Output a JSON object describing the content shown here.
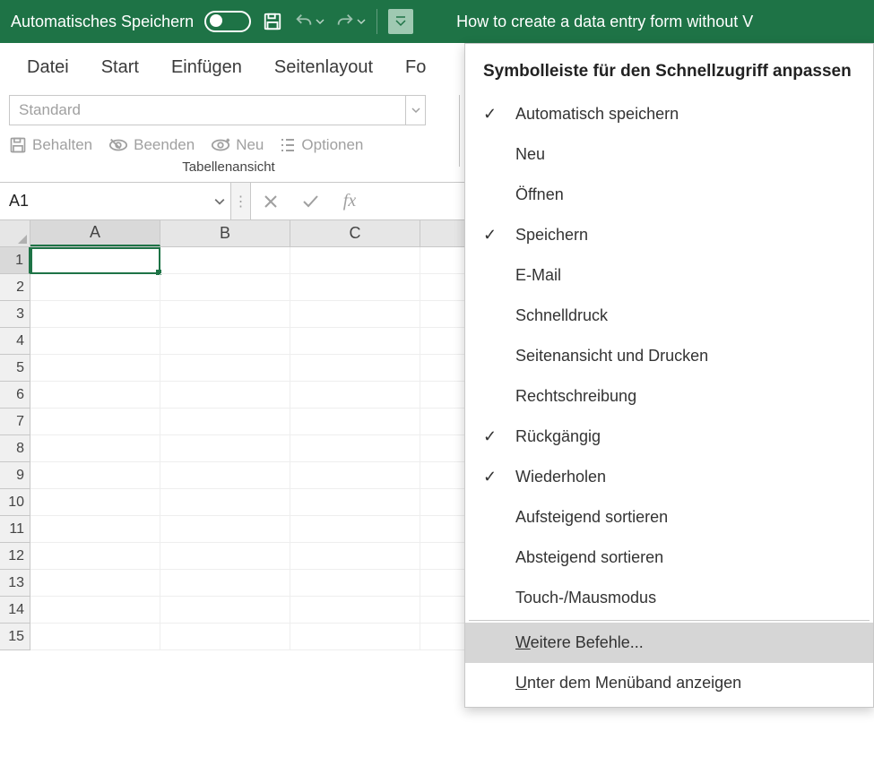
{
  "titlebar": {
    "autosave_label": "Automatisches Speichern",
    "doc_title": "How to create a data entry form without V"
  },
  "tabs": [
    "Datei",
    "Start",
    "Einfügen",
    "Seitenlayout",
    "Fo"
  ],
  "ribbon": {
    "style_value": "Standard",
    "keep": "Behalten",
    "exit": "Beenden",
    "new": "Neu",
    "options": "Optionen",
    "group_label": "Tabellenansicht"
  },
  "formula_bar": {
    "name_box": "A1",
    "fx": "fx"
  },
  "sheet": {
    "columns": [
      "A",
      "B",
      "C"
    ],
    "rows": [
      "1",
      "2",
      "3",
      "4",
      "5",
      "6",
      "7",
      "8",
      "9",
      "10",
      "11",
      "12",
      "13",
      "14",
      "15"
    ],
    "active": "A1"
  },
  "qat_menu": {
    "title": "Symbolleiste für den Schnellzugriff anpassen",
    "items": [
      {
        "label": "Automatisch speichern",
        "checked": true
      },
      {
        "label": "Neu",
        "checked": false
      },
      {
        "label": "Öffnen",
        "checked": false
      },
      {
        "label": "Speichern",
        "checked": true
      },
      {
        "label": "E-Mail",
        "checked": false
      },
      {
        "label": "Schnelldruck",
        "checked": false
      },
      {
        "label": "Seitenansicht und Drucken",
        "checked": false
      },
      {
        "label": "Rechtschreibung",
        "checked": false
      },
      {
        "label": "Rückgängig",
        "checked": true
      },
      {
        "label": "Wiederholen",
        "checked": true
      },
      {
        "label": "Aufsteigend sortieren",
        "checked": false
      },
      {
        "label": "Absteigend sortieren",
        "checked": false
      },
      {
        "label": "Touch-/Mausmodus",
        "checked": false
      }
    ],
    "more": "Weitere Befehle...",
    "below": "Unter dem Menüband anzeigen"
  }
}
